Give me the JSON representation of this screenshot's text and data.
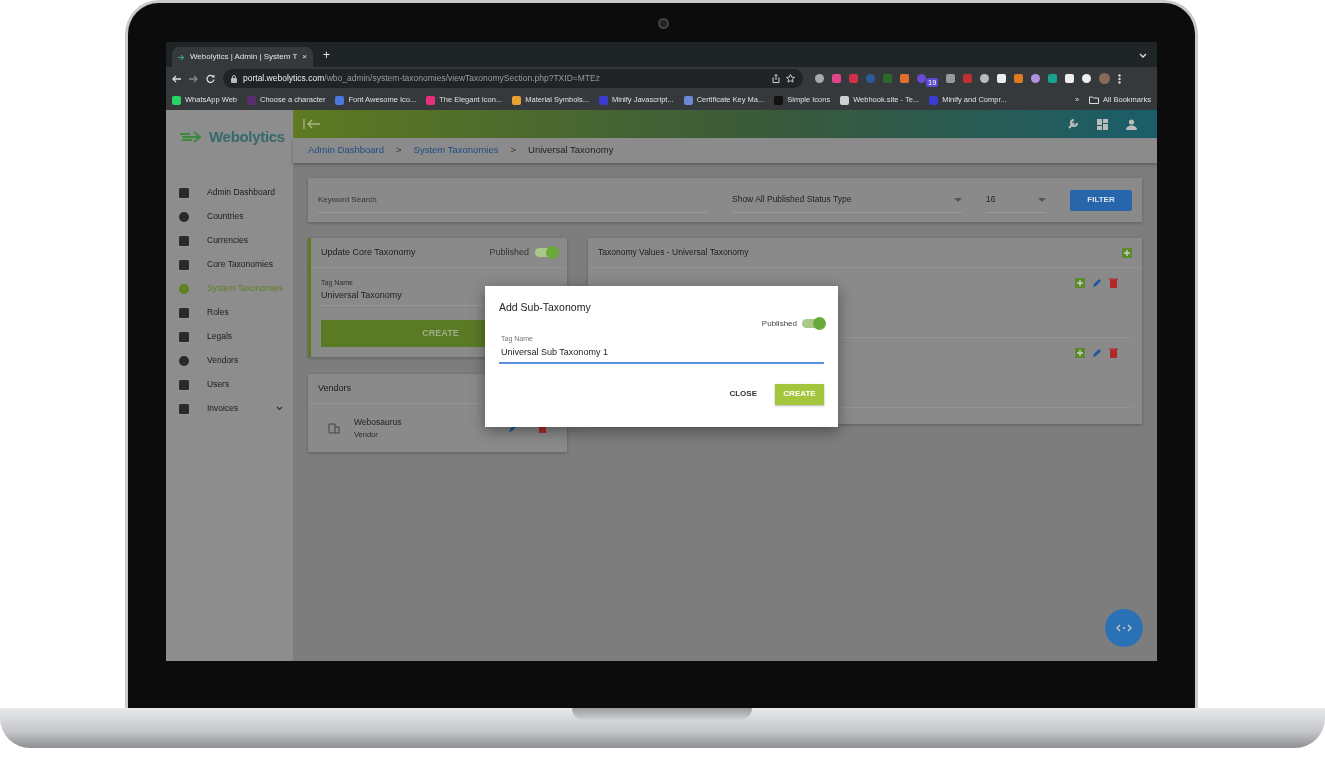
{
  "browser": {
    "tab_title": "Webolytics | Admin | System T",
    "close_tab": "×",
    "new_tab": "+",
    "url_host": "portal.webolytics.com",
    "url_path": "/wbo_admin/system-taxonomies/viewTaxonomySection.php?TXID=MTEz",
    "extension_badge": "19",
    "bookmarks": [
      {
        "label": "WhatsApp Web",
        "color": "#25d366"
      },
      {
        "label": "Choose a character",
        "color": "#5b2d6e"
      },
      {
        "label": "Font Awesome Ico...",
        "color": "#4a78e0"
      },
      {
        "label": "The Elegant Icon...",
        "color": "#e8307a"
      },
      {
        "label": "Material Symbols...",
        "color": "#e8a030"
      },
      {
        "label": "Minify Javascript...",
        "color": "#3b3bd0"
      },
      {
        "label": "Certificate Key Ma...",
        "color": "#6a8ad8"
      },
      {
        "label": "Simple Icons",
        "color": "#111111"
      },
      {
        "label": "Webhook.site - Te...",
        "color": "#d0d0d0"
      },
      {
        "label": "Minify and Compr...",
        "color": "#3b3bd0"
      }
    ],
    "bookmarks_more": "»",
    "all_bookmarks": "All Bookmarks"
  },
  "app": {
    "brand": "Webolytics",
    "sidebar": [
      {
        "label": "Admin Dashboard",
        "selected": false,
        "has_submenu": false
      },
      {
        "label": "Countries",
        "selected": false,
        "has_submenu": false
      },
      {
        "label": "Currencies",
        "selected": false,
        "has_submenu": false
      },
      {
        "label": "Core Taxonomies",
        "selected": false,
        "has_submenu": false
      },
      {
        "label": "System Taxonomies",
        "selected": true,
        "has_submenu": false
      },
      {
        "label": "Roles",
        "selected": false,
        "has_submenu": false
      },
      {
        "label": "Legals",
        "selected": false,
        "has_submenu": false
      },
      {
        "label": "Vendors",
        "selected": false,
        "has_submenu": false
      },
      {
        "label": "Users",
        "selected": false,
        "has_submenu": false
      },
      {
        "label": "Invoices",
        "selected": false,
        "has_submenu": true
      }
    ],
    "breadcrumbs": [
      {
        "label": "Admin Dashboard",
        "kind": "link"
      },
      {
        "label": "System Taxonomies",
        "kind": "link"
      },
      {
        "label": "Universal Taxonomy",
        "kind": "current"
      }
    ],
    "breadcrumb_separator": ">",
    "filter": {
      "search_placeholder": "Keyword Search",
      "status_select": "Show All Published Status Type",
      "count_select": "16",
      "button": "FILTER"
    },
    "core_card": {
      "title": "Update Core Taxonomy",
      "published_label": "Published",
      "published": true,
      "field_label": "Tag Name",
      "field_value": "Universal Taxonomy",
      "button": "CREATE"
    },
    "vendors_card": {
      "title": "Vendors",
      "items": [
        {
          "name": "Webosaurus",
          "role": "Vendor"
        }
      ]
    },
    "values_card": {
      "title": "Taxonomy Values - Universal Taxonomy"
    },
    "modal": {
      "title": "Add Sub-Taxonomy",
      "published_label": "Published",
      "published": true,
      "field_label": "Tag Name",
      "field_value": "Universal Sub Taxonomy 1",
      "buttons": [
        {
          "label": "CLOSE",
          "kind": "text"
        },
        {
          "label": "CREATE",
          "kind": "primary"
        }
      ]
    }
  }
}
